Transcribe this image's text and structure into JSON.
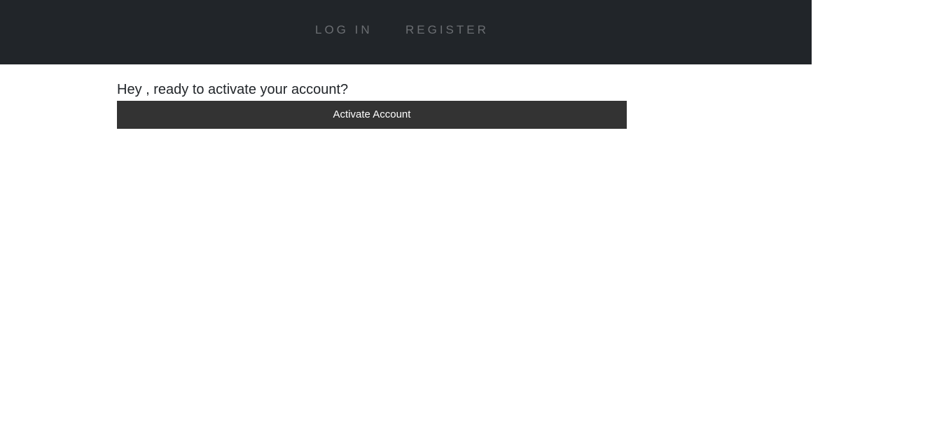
{
  "nav": {
    "login_label": "LOG IN",
    "register_label": "REGISTER",
    "background_color": "#212529",
    "link_color": "#6b6e72"
  },
  "main": {
    "greeting": "Hey , ready to activate your account?",
    "activate_button_label": "Activate Account",
    "button_color": "#333333"
  }
}
